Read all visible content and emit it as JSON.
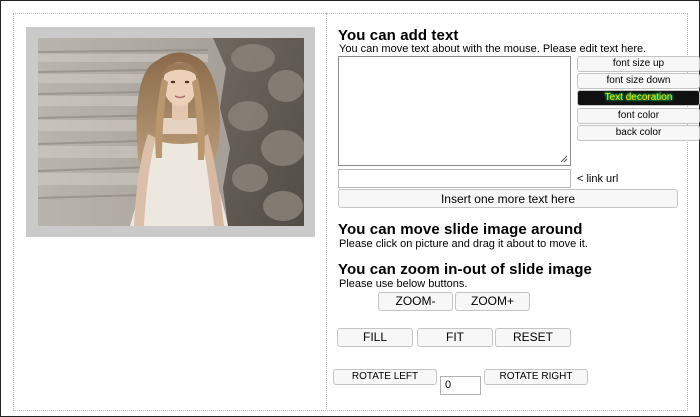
{
  "text_section": {
    "title": "You can add text",
    "instruction": "You can move text about with the mouse. Please edit text here.",
    "textarea_value": "",
    "buttons": {
      "font_size_up": "font size up",
      "font_size_down": "font size down",
      "text_decoration": "Text decoration",
      "font_color": "font color",
      "back_color": "back color"
    },
    "link_url_value": "",
    "link_url_label": "< link url",
    "insert_button": "Insert one more text here"
  },
  "move_section": {
    "title": "You can move slide image around",
    "instruction": "Please click on picture and drag it about to move it."
  },
  "zoom_section": {
    "title": "You can zoom in-out of slide image",
    "instruction": "Please use below buttons.",
    "zoom_out": "ZOOM-",
    "zoom_in": "ZOOM+"
  },
  "fit_buttons": {
    "fill": "FILL",
    "fit": "FIT",
    "reset": "RESET"
  },
  "rotate": {
    "left": "ROTATE LEFT",
    "right": "ROTATE RIGHT",
    "value": "0"
  },
  "colors": {
    "image_holder_bg": "#cacaca",
    "button_bg": "#f7f7f7",
    "decoration_bg": "#111111",
    "decoration_text": "#ffdd00",
    "decoration_glow": "#00ff66"
  }
}
